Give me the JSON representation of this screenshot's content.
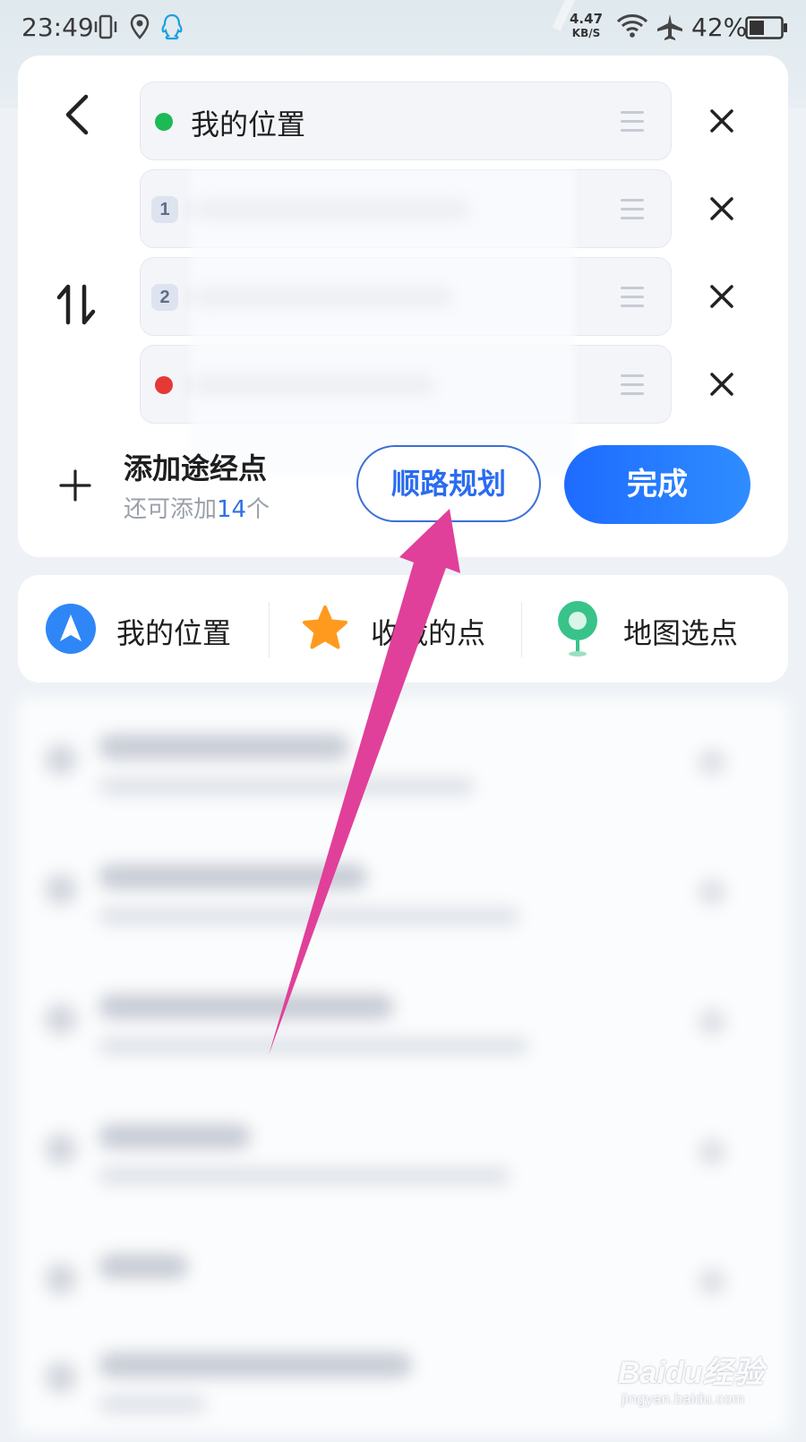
{
  "status_bar": {
    "time": "23:49",
    "net_speed_value": "4.47",
    "net_speed_unit": "KB/S",
    "battery": "42%",
    "icons": [
      "vibrate-icon",
      "location-icon",
      "qq-icon",
      "wifi-icon",
      "airplane-icon",
      "battery-icon"
    ]
  },
  "route": {
    "stops": [
      {
        "type": "start",
        "label": "我的位置",
        "marker_color": "#1db954"
      },
      {
        "type": "waypoint",
        "badge": "1"
      },
      {
        "type": "waypoint",
        "badge": "2"
      },
      {
        "type": "end",
        "marker_color": "#e53935"
      }
    ],
    "add_waypoint_title": "添加途经点",
    "add_waypoint_prefix": "还可添加",
    "add_waypoint_count": "14",
    "add_waypoint_suffix": "个",
    "plan_button": "顺路规划",
    "done_button": "完成"
  },
  "quick_picks": [
    {
      "label": "我的位置",
      "icon": "navigation-arrow-icon"
    },
    {
      "label": "收藏的点",
      "icon": "star-icon"
    },
    {
      "label": "地图选点",
      "icon": "map-pin-icon"
    }
  ],
  "annotation": {
    "arrow_color": "#e0409a"
  },
  "watermark": {
    "main": "Baidu经验",
    "sub": "jingyan.baidu.com"
  },
  "colors": {
    "accent": "#2a6cf0",
    "done_gradient_start": "#1e6bff",
    "done_gradient_end": "#2e8dff"
  }
}
